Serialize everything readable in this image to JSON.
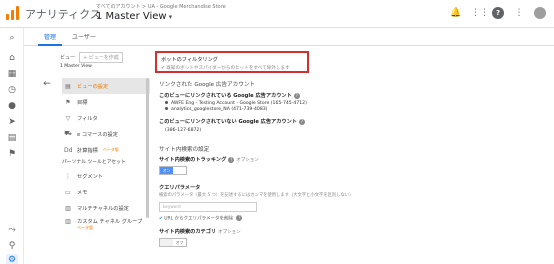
{
  "header": {
    "app_name": "アナリティクス",
    "account_path": "すべてのアカウント > UA - Google Merchandise Store",
    "view_name": "1 Master View",
    "icons": [
      "bell-icon",
      "apps-icon",
      "help-icon",
      "more-icon",
      "avatar"
    ]
  },
  "tabs": [
    "管理",
    "ユーザー"
  ],
  "view_column": {
    "label": "ビュー",
    "create_button": "+ ビューを作成",
    "selected_view": "1 Master View",
    "items": [
      {
        "label": "ビューの設定",
        "icon": "doc-icon",
        "active": true
      },
      {
        "label": "目標",
        "icon": "flag-icon"
      },
      {
        "label": "フィルタ",
        "icon": "filter-icon"
      },
      {
        "label": "e コマースの設定",
        "icon": "cart-icon"
      },
      {
        "label": "計算指標",
        "icon": "calc-icon",
        "badge": "ベータ版"
      }
    ],
    "section": "パーソナル ツールとアセット",
    "personal_items": [
      {
        "label": "セグメント",
        "icon": "segments-icon"
      },
      {
        "label": "メモ",
        "icon": "note-icon"
      },
      {
        "label": "マルチチャネルの設定",
        "icon": "channels-icon"
      },
      {
        "label": "カスタム チャネル グループ",
        "icon": "group-icon",
        "badge": "ベータ版"
      }
    ]
  },
  "content": {
    "bot_filter": {
      "title": "ボットのフィルタリング",
      "checkbox_label": "既知のボットやスパイダーからのヒットをすべて除外します",
      "checked": true
    },
    "linked_ads_title": "リンクされた Google 広告アカウント",
    "linked_label": "このビューにリンクされている Google 広告アカウント",
    "linked_accounts": [
      "AWFE Eng - Testing Account - Google Store (165-745-4712)",
      "analytics_googlestore_NA (471-739-4083)"
    ],
    "unlinked_label": "このビューにリンクされていない Google 広告アカウント",
    "unlinked_accounts": [
      "(386-127-6872)"
    ],
    "site_search_title": "サイト内検索の設定",
    "site_tracking_label": "サイト内検索のトラッキング",
    "optional": "オプション",
    "toggle_on": "オン",
    "toggle_off": "オフ",
    "query_param_label": "クエリパラメータ",
    "query_param_desc": "検索のパラメータ（最大 5 つ）を記述するにはカンマを使用します（大文字と小文字を区別しない）",
    "query_param_placeholder": "keyword",
    "strip_label": "URL からクエリパラメータを削除",
    "site_category_label": "サイト内検索のカテゴリ",
    "toggle_off2": "オフ"
  }
}
